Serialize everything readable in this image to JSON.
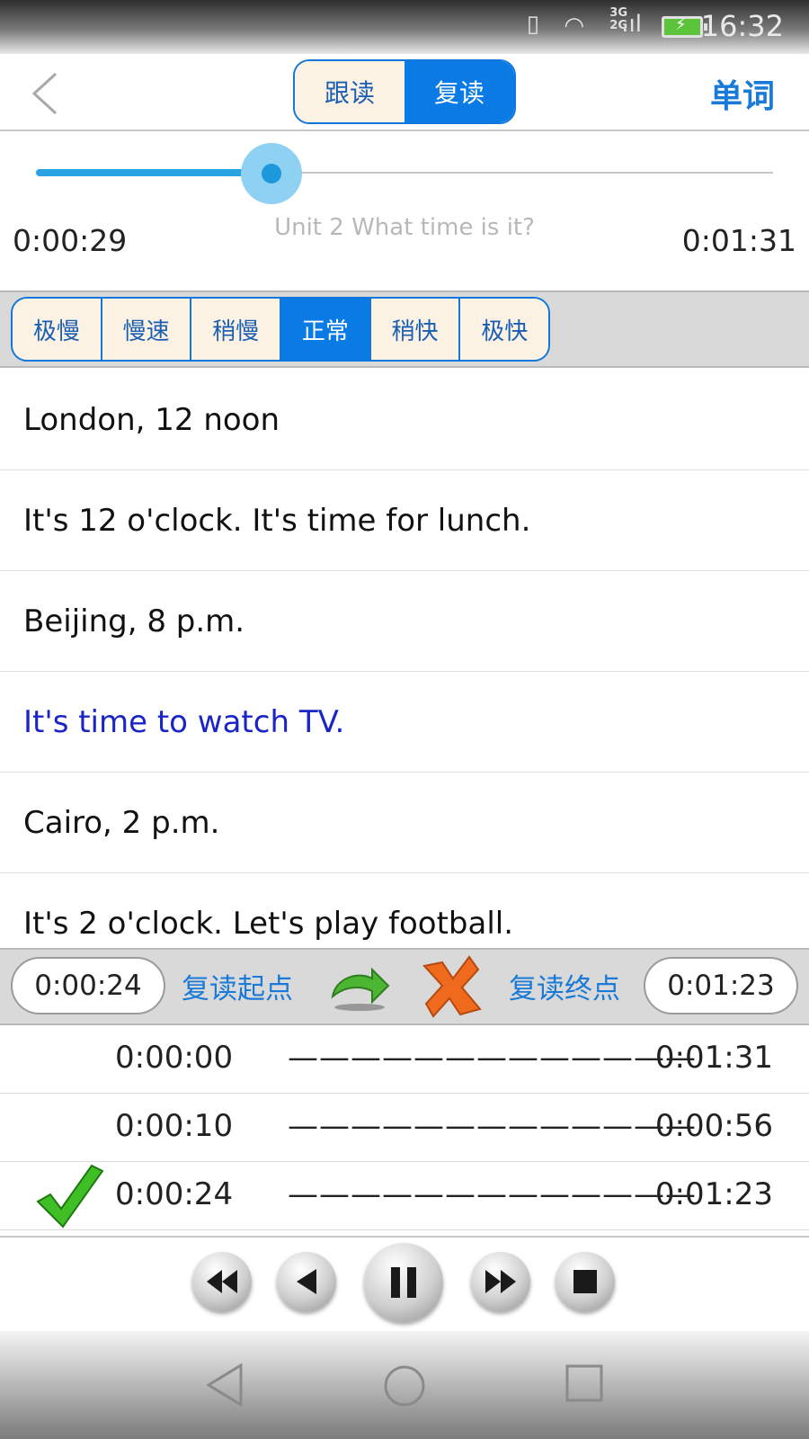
{
  "status_bar": {
    "time": "16:32",
    "network_top": "3G",
    "network_bottom": "2G",
    "battery_color": "#5cc43a"
  },
  "header": {
    "mode_tabs": [
      {
        "label": "跟读",
        "selected": false
      },
      {
        "label": "复读",
        "selected": true
      }
    ],
    "words_button": "单词",
    "accent": "#0a7be5"
  },
  "player": {
    "current_time": "0:00:29",
    "total_time": "0:01:31",
    "title": "Unit 2 What time is it?",
    "progress_fraction": 0.32
  },
  "speeds": [
    {
      "label": "极慢",
      "selected": false
    },
    {
      "label": "慢速",
      "selected": false
    },
    {
      "label": "稍慢",
      "selected": false
    },
    {
      "label": "正常",
      "selected": true
    },
    {
      "label": "稍快",
      "selected": false
    },
    {
      "label": "极快",
      "selected": false
    }
  ],
  "lines": [
    {
      "text": "London, 12 noon",
      "active": false
    },
    {
      "text": "It's 12 o'clock. It's time for lunch.",
      "active": false
    },
    {
      "text": "Beijing, 8 p.m.",
      "active": false
    },
    {
      "text": "It's time to watch TV.",
      "active": true
    },
    {
      "text": "Cairo, 2 p.m.",
      "active": false
    },
    {
      "text": "It's 2 o'clock. Let's play football.",
      "active": false
    }
  ],
  "repeat": {
    "start_time": "0:00:24",
    "start_label": "复读起点",
    "end_label": "复读终点",
    "end_time": "0:01:23"
  },
  "history": [
    {
      "start": "0:00:00",
      "dashes": "—————————————",
      "end": "0:01:31",
      "checked": false
    },
    {
      "start": "0:00:10",
      "dashes": "—————————————",
      "end": "0:00:56",
      "checked": false
    },
    {
      "start": "0:00:24",
      "dashes": "—————————————",
      "end": "0:01:23",
      "checked": true
    }
  ],
  "controls": [
    "rewind-icon",
    "previous-icon",
    "pause-icon",
    "fast-forward-icon",
    "stop-icon"
  ]
}
